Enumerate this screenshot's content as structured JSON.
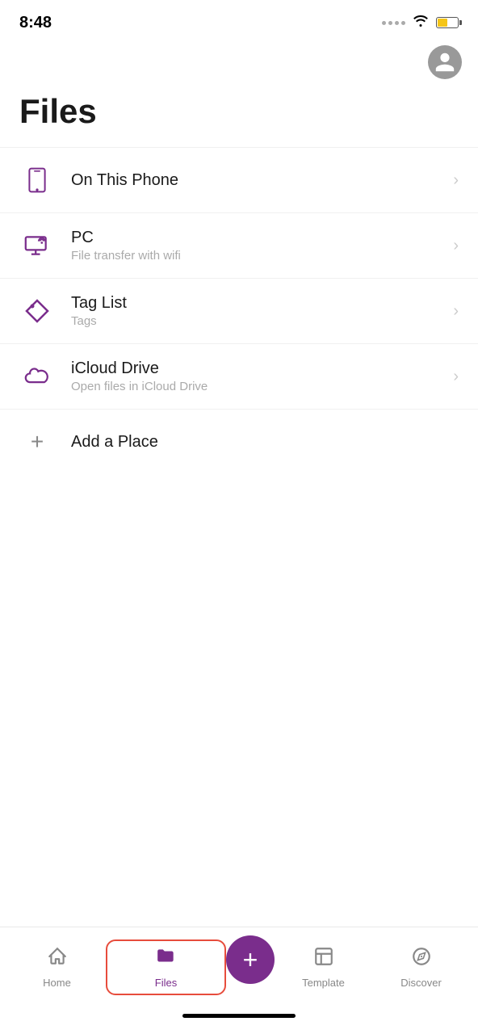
{
  "statusBar": {
    "time": "8:48"
  },
  "header": {
    "avatarIcon": "person"
  },
  "pageTitle": "Files",
  "menuItems": [
    {
      "id": "on-this-phone",
      "icon": "phone",
      "title": "On This Phone",
      "subtitle": "",
      "hasChevron": true
    },
    {
      "id": "pc",
      "icon": "wifi-monitor",
      "title": "PC",
      "subtitle": "File transfer with wifi",
      "hasChevron": true
    },
    {
      "id": "tag-list",
      "icon": "tag",
      "title": "Tag List",
      "subtitle": "Tags",
      "hasChevron": true
    },
    {
      "id": "icloud-drive",
      "icon": "cloud",
      "title": "iCloud Drive",
      "subtitle": "Open files in iCloud Drive",
      "hasChevron": true
    }
  ],
  "addItem": {
    "label": "Add a Place"
  },
  "tabBar": {
    "items": [
      {
        "id": "home",
        "label": "Home",
        "icon": "home",
        "active": false
      },
      {
        "id": "files",
        "label": "Files",
        "icon": "folder",
        "active": true
      },
      {
        "id": "template",
        "label": "Template",
        "icon": "template",
        "active": false
      },
      {
        "id": "discover",
        "label": "Discover",
        "icon": "compass",
        "active": false
      }
    ]
  }
}
